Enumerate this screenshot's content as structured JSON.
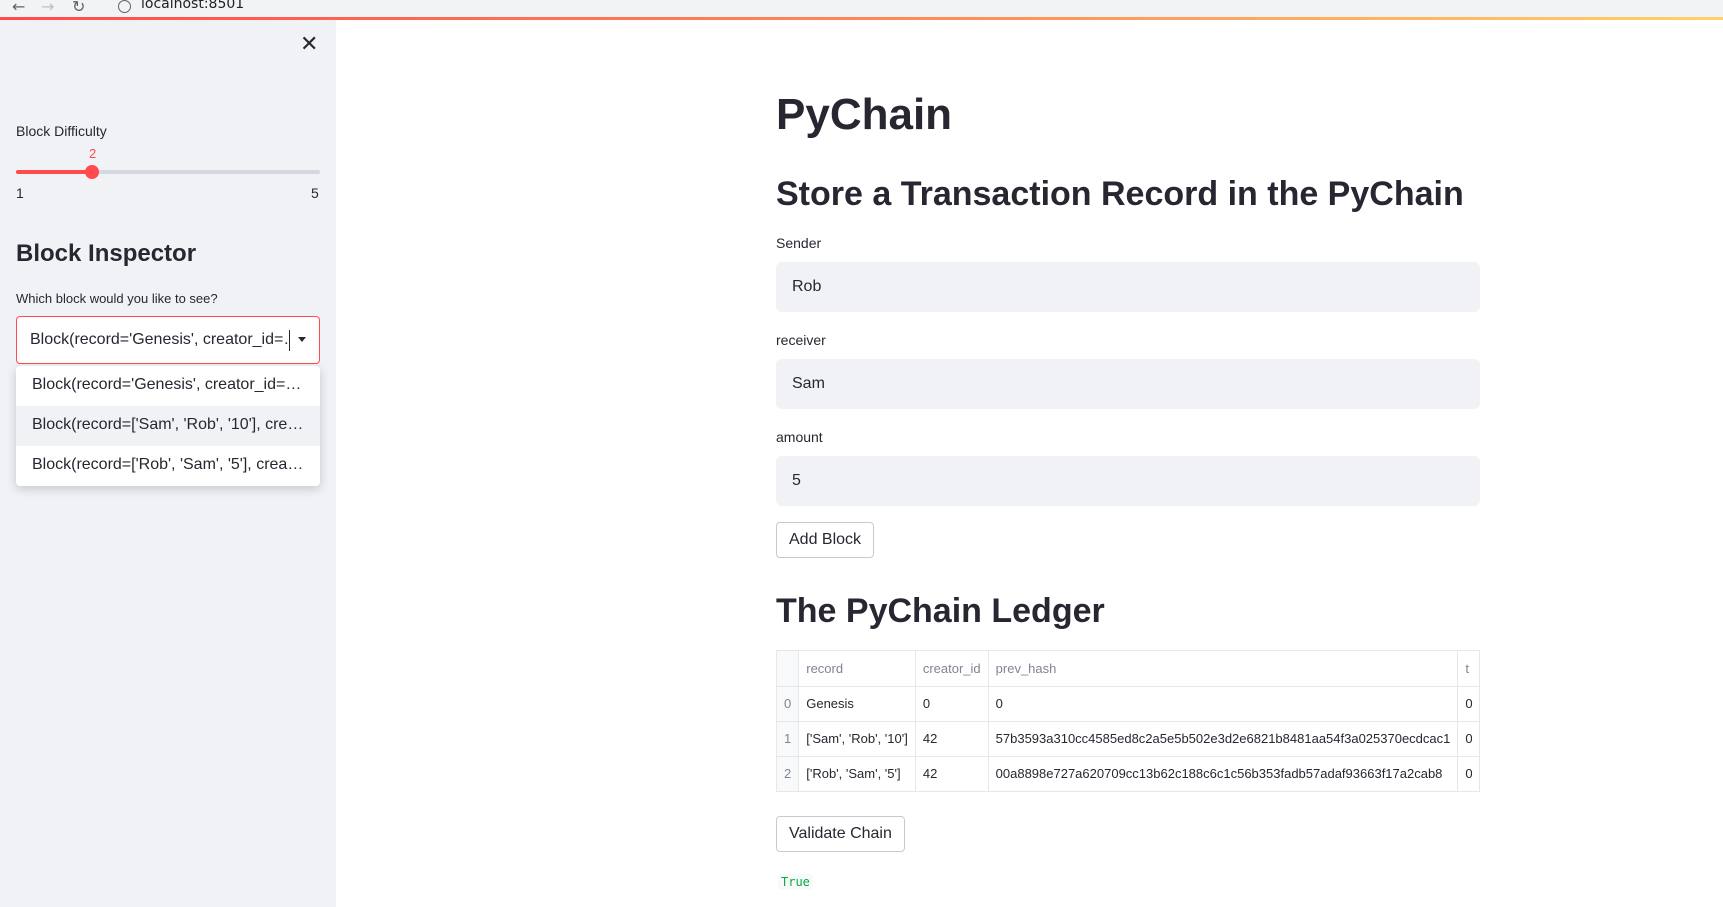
{
  "browser": {
    "back_icon": "←",
    "forward_icon": "→",
    "reload_icon": "↻",
    "url": "localhost:8501"
  },
  "sidebar": {
    "close_icon": "✕",
    "difficulty": {
      "label": "Block Difficulty",
      "value": 2,
      "value_text": "2",
      "min": 1,
      "max": 5,
      "min_text": "1",
      "max_text": "5"
    },
    "inspector": {
      "title": "Block Inspector",
      "prompt": "Which block would you like to see?",
      "selected": "Block(record='Genesis', creator_id=…",
      "options": [
        "Block(record='Genesis', creator_id=0, …",
        "Block(record=['Sam', 'Rob', '10'], creat…",
        "Block(record=['Rob', 'Sam', '5'], creator…"
      ]
    }
  },
  "main": {
    "title": "PyChain",
    "store_heading": "Store a Transaction Record in the PyChain",
    "fields": {
      "sender": {
        "label": "Sender",
        "value": "Rob"
      },
      "receiver": {
        "label": "receiver",
        "value": "Sam"
      },
      "amount": {
        "label": "amount",
        "value": "5"
      }
    },
    "add_block_label": "Add Block",
    "ledger_heading": "The PyChain Ledger",
    "ledger": {
      "columns": [
        "",
        "record",
        "creator_id",
        "prev_hash",
        "t"
      ],
      "rows": [
        [
          "0",
          "Genesis",
          "0",
          "0",
          "0"
        ],
        [
          "1",
          "['Sam', 'Rob', '10']",
          "42",
          "57b3593a310cc4585ed8c2a5e5b502e3d2e6821b8481aa54f3a025370ecdcac1",
          "0"
        ],
        [
          "2",
          "['Rob', 'Sam', '5']",
          "42",
          "00a8898e727a620709cc13b62c188c6c1c56b353fadb57adaf93663f17a2cab8",
          "0"
        ]
      ]
    },
    "validate_label": "Validate Chain",
    "validate_result": "True"
  },
  "colors": {
    "accent": "#ff4b4b",
    "sidebar_bg": "#f0f2f6",
    "input_bg": "#f0f2f6",
    "text": "#262730",
    "success_code": "#09ab3b"
  }
}
